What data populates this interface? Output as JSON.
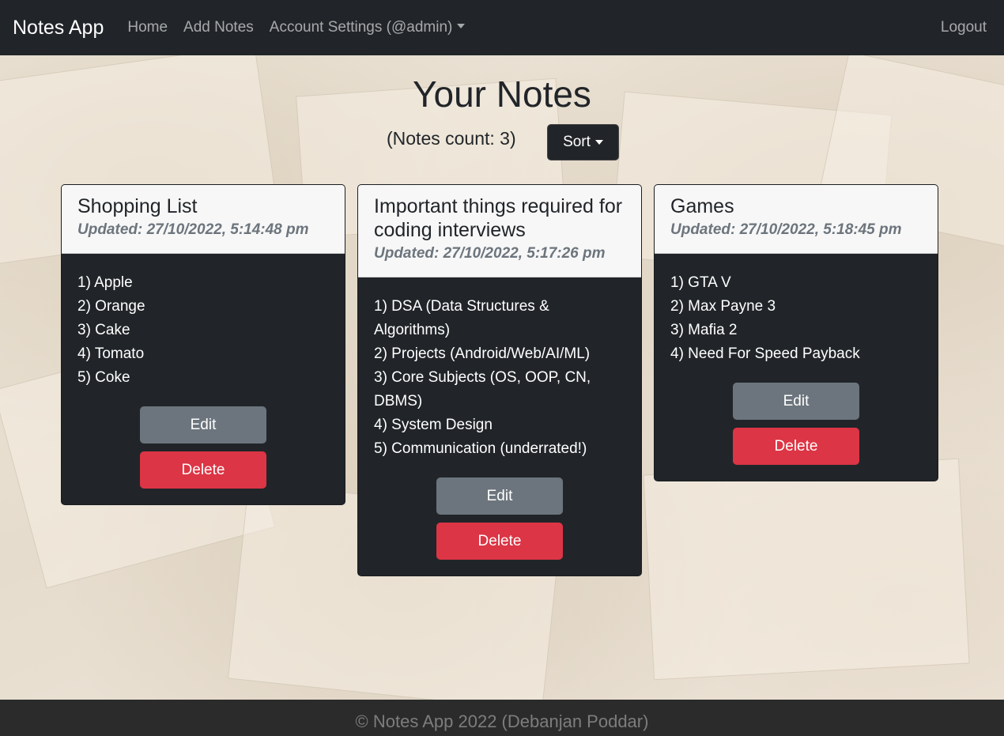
{
  "navbar": {
    "brand": "Notes App",
    "links": [
      "Home",
      "Add Notes"
    ],
    "account_label": "Account Settings (@admin)",
    "logout_label": "Logout"
  },
  "main": {
    "title": "Your Notes",
    "count_text": "(Notes count: 3)",
    "sort_label": "Sort"
  },
  "notes": [
    {
      "title": "Shopping List",
      "updated": "Updated: 27/10/2022, 5:14:48 pm",
      "lines": [
        "1) Apple",
        "2) Orange",
        "3) Cake",
        "4) Tomato",
        "5) Coke"
      ],
      "edit_label": "Edit",
      "delete_label": "Delete"
    },
    {
      "title": "Important things required for coding interviews",
      "updated": "Updated: 27/10/2022, 5:17:26 pm",
      "lines": [
        "1) DSA (Data Structures & Algorithms)",
        "2) Projects (Android/Web/AI/ML)",
        "3) Core Subjects (OS, OOP, CN, DBMS)",
        "4) System Design",
        "5) Communication (underrated!)"
      ],
      "edit_label": "Edit",
      "delete_label": "Delete"
    },
    {
      "title": "Games",
      "updated": "Updated: 27/10/2022, 5:18:45 pm",
      "lines": [
        "1) GTA V",
        "2) Max Payne 3",
        "3) Mafia 2",
        "4) Need For Speed Payback"
      ],
      "edit_label": "Edit",
      "delete_label": "Delete"
    }
  ],
  "footer": {
    "text": "© Notes App 2022 (Debanjan Poddar)"
  },
  "colors": {
    "navbar_bg": "#212529",
    "card_bg": "#212529",
    "edit_btn": "#6c757d",
    "delete_btn": "#dc3545"
  }
}
